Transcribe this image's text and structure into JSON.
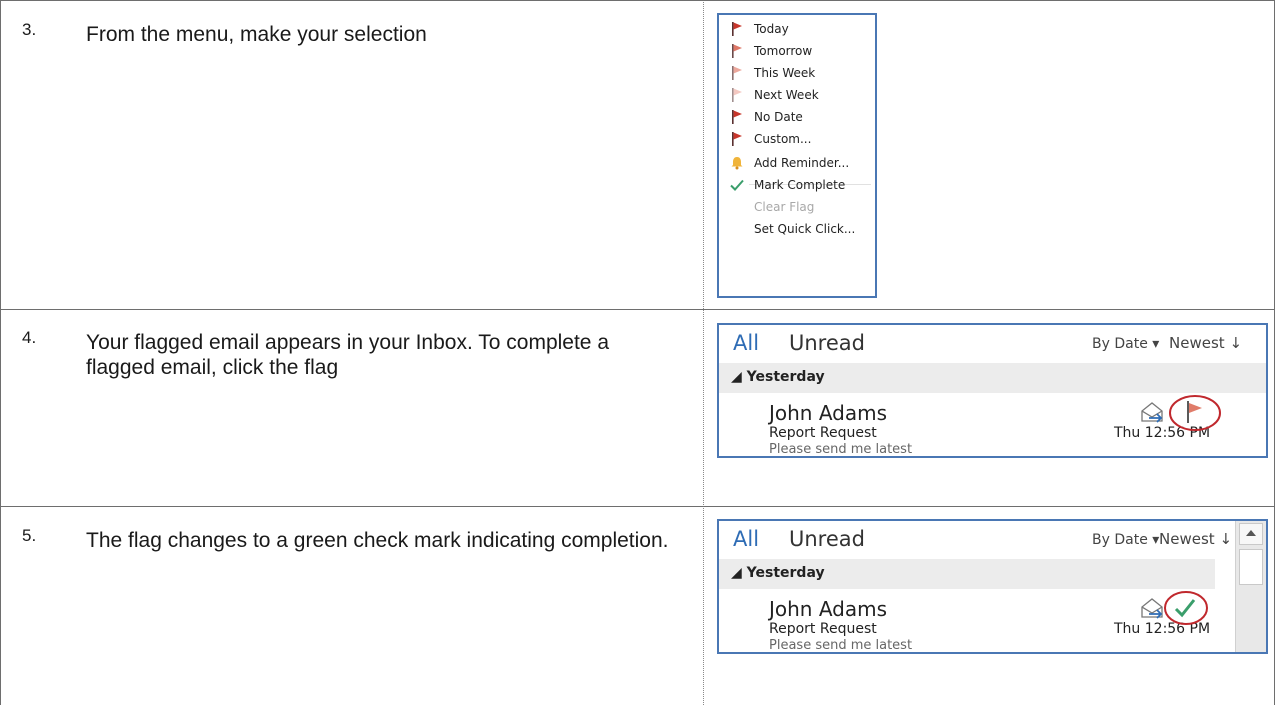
{
  "steps": [
    {
      "number": "3.",
      "text": "From the menu, make your selection"
    },
    {
      "number": "4.",
      "text": "Your flagged email appears in your Inbox. To complete a flagged email, click the flag"
    },
    {
      "number": "5.",
      "text": "The flag changes to a green check mark indicating completion."
    }
  ],
  "menu": {
    "items": [
      {
        "label": "Today",
        "icon": "red-flag-icon"
      },
      {
        "label": "Tomorrow",
        "icon": "red-flag-icon"
      },
      {
        "label": "This Week",
        "icon": "light-flag-icon"
      },
      {
        "label": "Next Week",
        "icon": "pale-flag-icon"
      },
      {
        "label": "No Date",
        "icon": "red-flag-icon"
      },
      {
        "label": "Custom...",
        "icon": "red-flag-icon"
      },
      {
        "label": "Add Reminder...",
        "icon": "bell-icon"
      },
      {
        "label": "Mark Complete",
        "icon": "checkmark-icon"
      },
      {
        "label": "Clear Flag",
        "icon": "",
        "disabled": true
      },
      {
        "label": "Set Quick Click...",
        "icon": ""
      }
    ]
  },
  "inbox": {
    "tab_all": "All",
    "tab_unread": "Unread",
    "sort_by": "By Date",
    "sort_order": "Newest",
    "group": "Yesterday",
    "email": {
      "sender": "John Adams",
      "subject": "Report Request",
      "preview": "Please send me latest",
      "time": "Thu 12:56 PM"
    }
  },
  "colors": {
    "accent": "#2e6cb5",
    "flag": "#e06c5a",
    "check": "#3a9e6b",
    "circle": "#c0282d",
    "border": "#4a77b4"
  }
}
